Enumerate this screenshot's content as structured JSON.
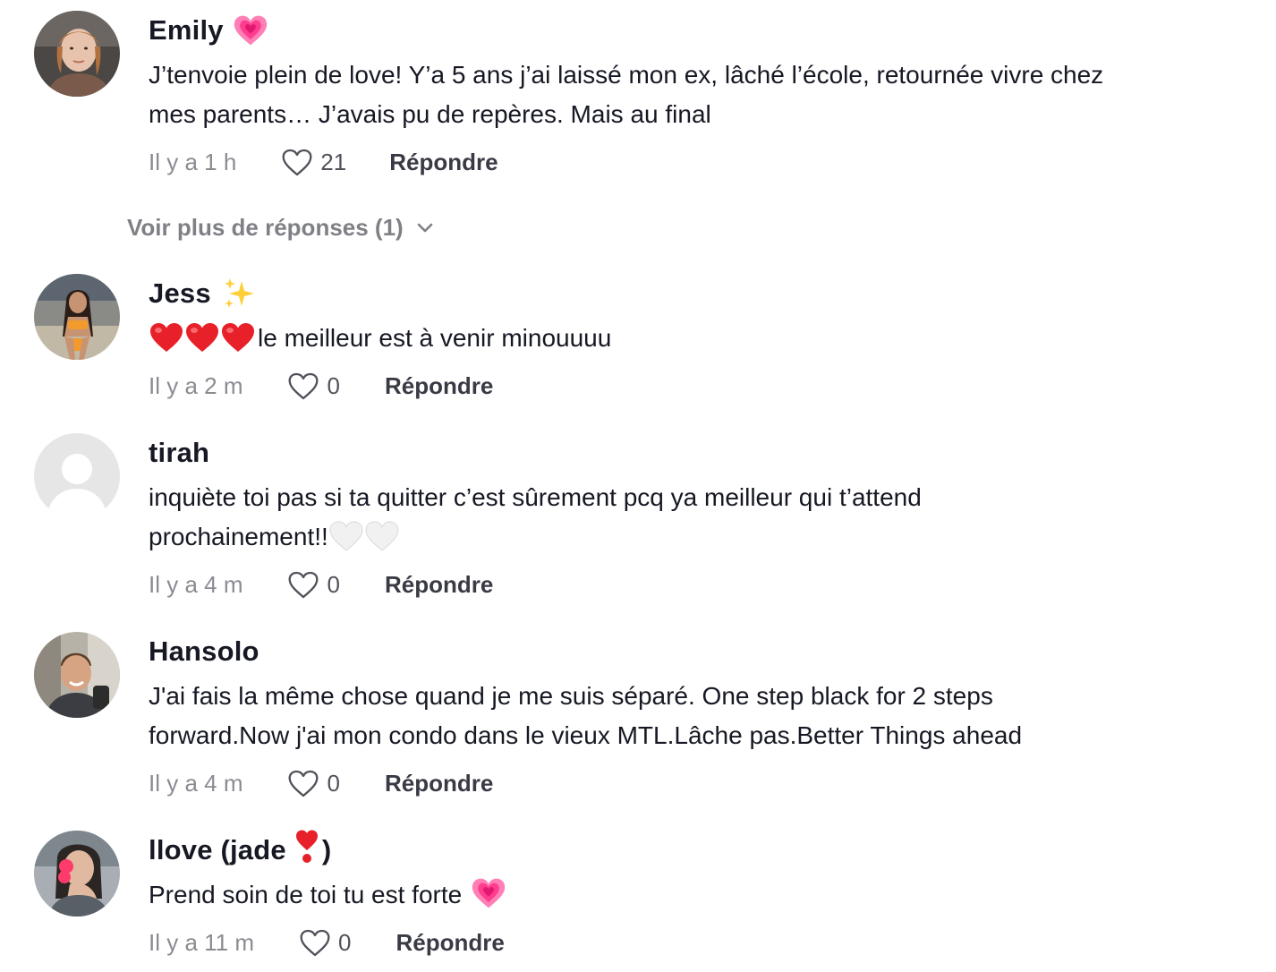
{
  "comments": [
    {
      "username": "Emily",
      "name_emoji": "growing-heart-icon",
      "text_lines": [
        "J’tenvoie plein de love! Y’a 5 ans j’ai laissé mon ex, lâché l’école, retournée vivre chez",
        "mes parents… J’avais pu de repères. Mais au final"
      ],
      "time": "Il y a 1 h",
      "likes": "21",
      "reply_label": "Répondre"
    },
    {
      "username": "Jess",
      "name_emoji": "sparkles-icon",
      "text_prefix_emoji": "three-red-hearts",
      "text_lines": [
        "le meilleur est à venir minouuuu"
      ],
      "time": "Il y a 2 m",
      "likes": "0",
      "reply_label": "Répondre"
    },
    {
      "username": "tirah",
      "text_lines": [
        "inquiète toi pas si ta quitter c’est sûrement pcq ya meilleur qui t’attend",
        "prochainement!!"
      ],
      "text_suffix_emoji": "two-white-hearts",
      "time": "Il y a 4 m",
      "likes": "0",
      "reply_label": "Répondre"
    },
    {
      "username": "Hansolo",
      "text_lines": [
        "J'ai fais la même chose quand je me suis séparé. One step black for 2 steps",
        "forward.Now j'ai mon condo dans le vieux MTL.Lâche pas.Better Things ahead"
      ],
      "time": "Il y a 4 m",
      "likes": "0",
      "reply_label": "Répondre"
    },
    {
      "username_before": "llove (jade",
      "username_after": ")",
      "name_emoji": "heart-exclamation-icon",
      "text_lines": [
        "Prend soin de toi tu est forte"
      ],
      "text_suffix_emoji": "growing-heart",
      "time": "Il y a 11 m",
      "likes": "0",
      "reply_label": "Répondre"
    }
  ],
  "more_replies_label": "Voir plus de réponses (1)",
  "colors": {
    "text": "#161823",
    "muted": "#8a8b91",
    "pink_heart": "#ff4f9a",
    "red_heart": "#e8202a"
  }
}
